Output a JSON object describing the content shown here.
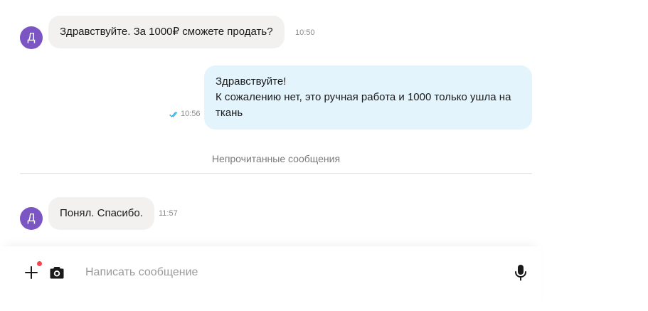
{
  "messages": [
    {
      "sender_initial": "Д",
      "text": "Здравствуйте. За 1000₽ сможете продать?",
      "time": "10:50"
    },
    {
      "line1": "Здравствуйте!",
      "line2": "К сожалению нет, это ручная работа и 1000 только ушла на",
      "line3": "ткань",
      "time": "10:56"
    },
    {
      "sender_initial": "Д",
      "text": "Понял. Спасибо.",
      "time": "11:57"
    }
  ],
  "divider": {
    "label": "Непрочитанные сообщения"
  },
  "composer": {
    "placeholder": "Написать сообщение"
  },
  "icons": {
    "attach": "plus-icon",
    "camera": "camera-icon",
    "mic": "microphone-icon",
    "read": "double-check-icon"
  },
  "colors": {
    "avatar": "#7b55c4",
    "incoming_bubble": "#f2f1f0",
    "outgoing_bubble": "#e3f4fd",
    "notification_dot": "#f5434f",
    "read_check": "#29a8e0"
  }
}
